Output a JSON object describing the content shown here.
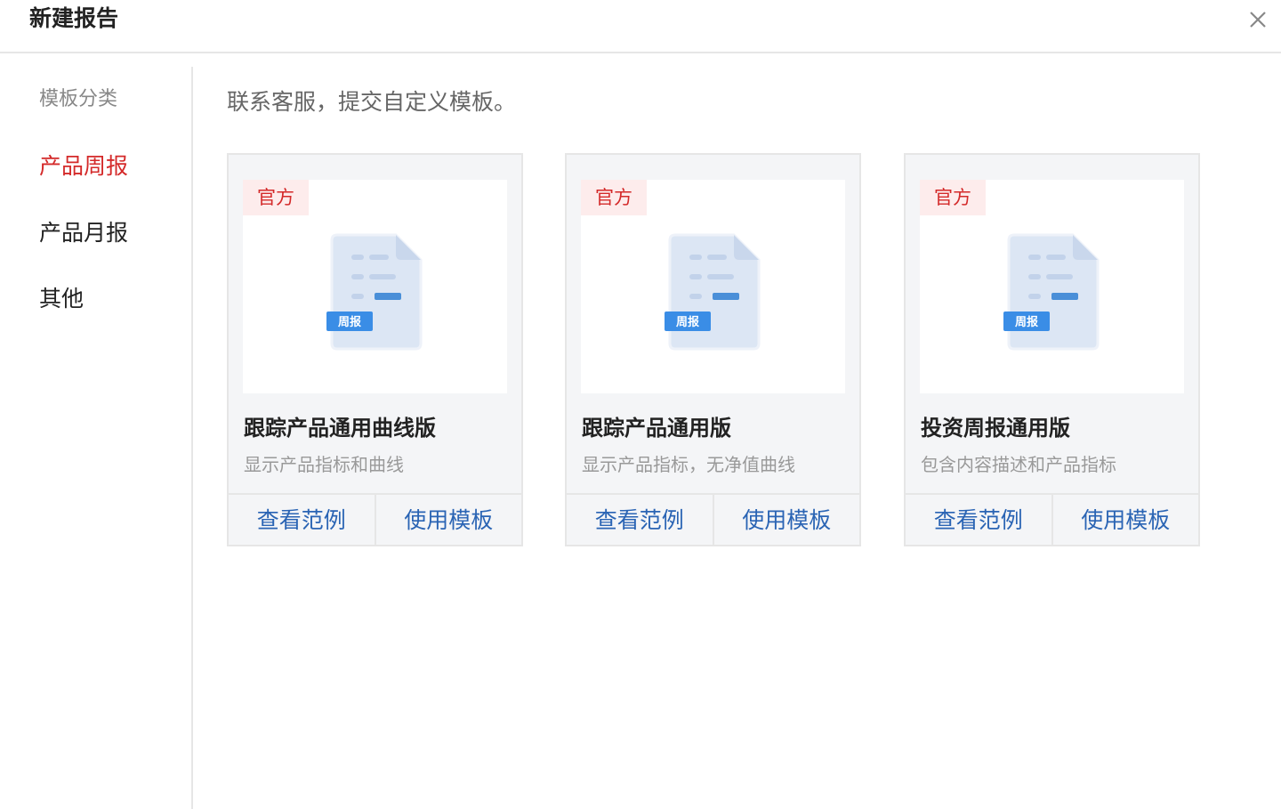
{
  "dialog": {
    "title": "新建报告"
  },
  "sidebar": {
    "heading": "模板分类",
    "items": [
      {
        "label": "产品周报",
        "active": true
      },
      {
        "label": "产品月报",
        "active": false
      },
      {
        "label": "其他",
        "active": false
      }
    ]
  },
  "main": {
    "hint": "联系客服，提交自定义模板。",
    "cards": [
      {
        "badge": "官方",
        "thumb_tag": "周报",
        "title": "跟踪产品通用曲线版",
        "description": "显示产品指标和曲线",
        "view_label": "查看范例",
        "use_label": "使用模板"
      },
      {
        "badge": "官方",
        "thumb_tag": "周报",
        "title": "跟踪产品通用版",
        "description": "显示产品指标，无净值曲线",
        "view_label": "查看范例",
        "use_label": "使用模板"
      },
      {
        "badge": "官方",
        "thumb_tag": "周报",
        "title": "投资周报通用版",
        "description": "包含内容描述和产品指标",
        "view_label": "查看范例",
        "use_label": "使用模板"
      }
    ]
  },
  "colors": {
    "accent": "#d42a2a",
    "link": "#2a64b4",
    "badge_bg": "#fdecec",
    "card_bg": "#f4f5f7"
  }
}
